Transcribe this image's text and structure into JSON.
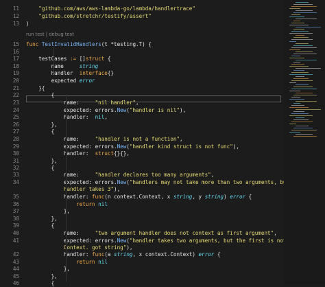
{
  "lens": "run test | debug test",
  "lines": [
    {
      "n": "11",
      "segs": [
        [
          "    ",
          "p"
        ],
        [
          "\"github.com/aws/aws-lambda-go/lambda/handlertrace\"",
          "s"
        ]
      ]
    },
    {
      "n": "12",
      "segs": [
        [
          "    ",
          "p"
        ],
        [
          "\"github.com/stretchr/testify/assert\"",
          "s"
        ]
      ]
    },
    {
      "n": "13",
      "segs": [
        [
          ")",
          "p"
        ]
      ]
    },
    {
      "n": "",
      "segs": []
    },
    {
      "n": "15",
      "segs": [
        [
          "func ",
          "kw"
        ],
        [
          "TestInvalidHandlers",
          "b"
        ],
        [
          "(t ",
          "p"
        ],
        [
          "*",
          "p"
        ],
        [
          "testing.T) {",
          "p"
        ]
      ]
    },
    {
      "n": "16",
      "segs": []
    },
    {
      "n": "17",
      "segs": [
        [
          "    testCases ",
          "p"
        ],
        [
          ":= ",
          "kw"
        ],
        [
          "[]",
          "p"
        ],
        [
          "struct",
          "kw"
        ],
        [
          " {",
          "p"
        ]
      ]
    },
    {
      "n": "18",
      "segs": [
        [
          "        name     ",
          "p"
        ],
        [
          "string",
          "t"
        ]
      ]
    },
    {
      "n": "19",
      "segs": [
        [
          "        handler  ",
          "p"
        ],
        [
          "interface",
          "kw"
        ],
        [
          "{}",
          "p"
        ]
      ]
    },
    {
      "n": "20",
      "segs": [
        [
          "        expected ",
          "p"
        ],
        [
          "error",
          "t"
        ]
      ]
    },
    {
      "n": "21",
      "segs": [
        [
          "    }{",
          "p"
        ]
      ]
    },
    {
      "n": "22",
      "segs": [
        [
          "        {",
          "p"
        ]
      ]
    },
    {
      "n": "23",
      "segs": [
        [
          "            name:     ",
          "p"
        ],
        [
          "\"nil handler\"",
          "s"
        ],
        [
          ",",
          "p"
        ]
      ]
    },
    {
      "n": "24",
      "segs": [
        [
          "            expected: errors.",
          "p"
        ],
        [
          "New",
          "b"
        ],
        [
          "(",
          "p"
        ],
        [
          "\"handler is nil\"",
          "s"
        ],
        [
          "),",
          "p"
        ]
      ]
    },
    {
      "n": "25",
      "segs": [
        [
          "            handler:  ",
          "p"
        ],
        [
          "nil",
          "n"
        ],
        [
          ",",
          "p"
        ]
      ]
    },
    {
      "n": "26",
      "segs": [
        [
          "        },",
          "p"
        ]
      ]
    },
    {
      "n": "27",
      "segs": [
        [
          "        {",
          "p"
        ]
      ]
    },
    {
      "n": "28",
      "segs": [
        [
          "            name:     ",
          "p"
        ],
        [
          "\"handler is not a function\"",
          "s"
        ],
        [
          ",",
          "p"
        ]
      ]
    },
    {
      "n": "29",
      "segs": [
        [
          "            expected: errors.",
          "p"
        ],
        [
          "New",
          "b"
        ],
        [
          "(",
          "p"
        ],
        [
          "\"handler kind struct is not func\"",
          "s"
        ],
        [
          "),",
          "p"
        ]
      ]
    },
    {
      "n": "30",
      "segs": [
        [
          "            handler:  ",
          "p"
        ],
        [
          "struct",
          "kw"
        ],
        [
          "{}{},",
          "p"
        ]
      ]
    },
    {
      "n": "31",
      "segs": [
        [
          "        },",
          "p"
        ]
      ]
    },
    {
      "n": "32",
      "segs": [
        [
          "        {",
          "p"
        ]
      ]
    },
    {
      "n": "33",
      "segs": [
        [
          "            name:     ",
          "p"
        ],
        [
          "\"handler declares too many arguments\"",
          "s"
        ],
        [
          ",",
          "p"
        ]
      ]
    },
    {
      "n": "34",
      "segs": [
        [
          "            expected: errors.",
          "p"
        ],
        [
          "New",
          "b"
        ],
        [
          "(",
          "p"
        ],
        [
          "\"handlers may not take more than two arguments, but",
          "s"
        ]
      ]
    },
    {
      "n": "",
      "segs": [
        [
          "            ",
          "p"
        ],
        [
          "handler takes 3\"",
          "s"
        ],
        [
          "),",
          "p"
        ]
      ]
    },
    {
      "n": "35",
      "segs": [
        [
          "            handler: ",
          "p"
        ],
        [
          "func",
          "kw"
        ],
        [
          "(n context.Context, x ",
          "p"
        ],
        [
          "string",
          "t"
        ],
        [
          ", y ",
          "p"
        ],
        [
          "string",
          "t"
        ],
        [
          ") ",
          "p"
        ],
        [
          "error",
          "t"
        ],
        [
          " {",
          "p"
        ]
      ]
    },
    {
      "n": "36",
      "segs": [
        [
          "                ",
          "p"
        ],
        [
          "return",
          "kw"
        ],
        [
          " ",
          "p"
        ],
        [
          "nil",
          "n"
        ]
      ]
    },
    {
      "n": "37",
      "segs": [
        [
          "            },",
          "p"
        ]
      ]
    },
    {
      "n": "38",
      "segs": [
        [
          "        },",
          "p"
        ]
      ]
    },
    {
      "n": "39",
      "segs": [
        [
          "        {",
          "p"
        ]
      ]
    },
    {
      "n": "40",
      "segs": [
        [
          "            name:     ",
          "p"
        ],
        [
          "\"two argument handler does not context as first argument\"",
          "s"
        ],
        [
          ",",
          "p"
        ]
      ]
    },
    {
      "n": "41",
      "segs": [
        [
          "            expected: errors.",
          "p"
        ],
        [
          "New",
          "b"
        ],
        [
          "(",
          "p"
        ],
        [
          "\"handler takes two arguments, but the first is not",
          "s"
        ]
      ]
    },
    {
      "n": "",
      "segs": [
        [
          "            ",
          "p"
        ],
        [
          "Context. got string\"",
          "s"
        ],
        [
          "),",
          "p"
        ]
      ]
    },
    {
      "n": "42",
      "segs": [
        [
          "            handler: ",
          "p"
        ],
        [
          "func",
          "kw"
        ],
        [
          "(a ",
          "p"
        ],
        [
          "string",
          "t"
        ],
        [
          ", x context.Context) ",
          "p"
        ],
        [
          "error",
          "t"
        ],
        [
          " {",
          "p"
        ]
      ]
    },
    {
      "n": "43",
      "segs": [
        [
          "                ",
          "p"
        ],
        [
          "return",
          "kw"
        ],
        [
          " ",
          "p"
        ],
        [
          "nil",
          "n"
        ]
      ]
    },
    {
      "n": "44",
      "segs": [
        [
          "            },",
          "p"
        ]
      ]
    },
    {
      "n": "45",
      "segs": [
        [
          "        },",
          "p"
        ]
      ]
    },
    {
      "n": "46",
      "segs": [
        [
          "        {",
          "p"
        ]
      ]
    }
  ]
}
